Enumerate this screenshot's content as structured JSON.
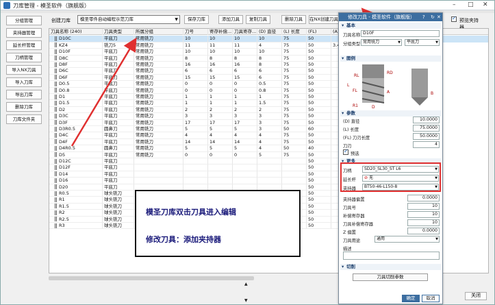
{
  "window": {
    "title": "刀库管理 - 模圣软件（旗舰版）"
  },
  "sidebar": {
    "buttons": [
      "分组管理",
      "夹持器管理",
      "延长杆管理",
      "刀柄管理",
      "导入NX刀具",
      "导入刀库",
      "导出刀库",
      "删除刀库",
      "刀库文件夹"
    ]
  },
  "toolbar": {
    "create_label": "创建刀库",
    "combo_value": "模圣零件自动编程示范刀库",
    "save": "保存刀库",
    "add": "添加刀具",
    "copy": "复制刀具",
    "delete": "删除刀具",
    "nx_create": "在NX创建刀具",
    "preview": "预览夹持器"
  },
  "columns": [
    "刀具名称 (240)",
    "刀具类型",
    "所属分组",
    "刀号",
    "寄存补偿...",
    "刀具寄存...",
    "(D) 直径",
    "(L) 长度",
    "(FL)",
    "(A) 尖角",
    "(B) 锥角"
  ],
  "rows": [
    [
      "D10C",
      "平底刀",
      "常用铣刀",
      "10",
      "10",
      "10",
      "10",
      "75",
      "50",
      "",
      "0"
    ],
    [
      "KZ4",
      "铣刀5",
      "常用铣刀",
      "11",
      "11",
      "11",
      "4",
      "75",
      "50",
      "3.44",
      "0"
    ],
    [
      "D10F",
      "平底刀",
      "常用铣刀",
      "10",
      "10",
      "10",
      "10",
      "75",
      "50",
      "",
      "0"
    ],
    [
      "D8C",
      "平底刀",
      "常用铣刀",
      "8",
      "8",
      "8",
      "8",
      "75",
      "50",
      "",
      "0"
    ],
    [
      "D8F",
      "平底刀",
      "常用铣刀",
      "16",
      "16",
      "16",
      "8",
      "75",
      "50",
      "",
      "0"
    ],
    [
      "D6C",
      "平底刀",
      "常用铣刀",
      "6",
      "6",
      "6",
      "6",
      "75",
      "50",
      "",
      "0"
    ],
    [
      "D6F",
      "平底刀",
      "常用铣刀",
      "15",
      "15",
      "15",
      "6",
      "75",
      "50",
      "",
      "0"
    ],
    [
      "D0.5",
      "平底刀",
      "常用铣刀",
      "0",
      "0",
      "0",
      "0.5",
      "75",
      "50",
      "",
      "0"
    ],
    [
      "D0.8",
      "平底刀",
      "常用铣刀",
      "0",
      "0",
      "0",
      "0.8",
      "75",
      "50",
      "",
      "0"
    ],
    [
      "D1",
      "平底刀",
      "常用铣刀",
      "1",
      "1",
      "1",
      "1",
      "75",
      "50",
      "",
      "0"
    ],
    [
      "D1.5",
      "平底刀",
      "常用铣刀",
      "1",
      "1",
      "1",
      "1.5",
      "75",
      "50",
      "",
      "0"
    ],
    [
      "D2",
      "平底刀",
      "常用铣刀",
      "2",
      "2",
      "2",
      "2",
      "75",
      "50",
      "",
      "0"
    ],
    [
      "D3C",
      "平底刀",
      "常用铣刀",
      "3",
      "3",
      "3",
      "3",
      "75",
      "50",
      "",
      "0"
    ],
    [
      "D3F",
      "平底刀",
      "常用铣刀",
      "17",
      "17",
      "17",
      "3",
      "75",
      "50",
      "",
      "0"
    ],
    [
      "D3R0.5",
      "圆鼻刀",
      "常用铣刀",
      "5",
      "5",
      "5",
      "3",
      "50",
      "60",
      "",
      "0"
    ],
    [
      "D4C",
      "平底刀",
      "常用铣刀",
      "4",
      "4",
      "4",
      "4",
      "75",
      "50",
      "",
      "0"
    ],
    [
      "D4F",
      "平底刀",
      "常用铣刀",
      "14",
      "14",
      "14",
      "4",
      "75",
      "50",
      "",
      "0"
    ],
    [
      "D4R0.5",
      "圆鼻刀",
      "常用铣刀",
      "5",
      "5",
      "5",
      "4",
      "50",
      "40",
      "",
      "0"
    ],
    [
      "D5",
      "平底刀",
      "常用铣刀",
      "0",
      "0",
      "0",
      "5",
      "75",
      "50",
      "",
      "0"
    ],
    [
      "D12C",
      "平底刀",
      "",
      "",
      "",
      "",
      "",
      "",
      "50",
      "",
      "0"
    ],
    [
      "D12F",
      "平底刀",
      "",
      "",
      "",
      "",
      "",
      "",
      "50",
      "",
      "0"
    ],
    [
      "D14",
      "平底刀",
      "",
      "",
      "",
      "",
      "",
      "",
      "50",
      "",
      "0"
    ],
    [
      "D16",
      "平底刀",
      "",
      "",
      "",
      "",
      "",
      "",
      "50",
      "",
      "0"
    ],
    [
      "D20",
      "平底刀",
      "",
      "",
      "",
      "",
      "",
      "",
      "50",
      "",
      "0"
    ],
    [
      "R0.5",
      "球头铣刀",
      "",
      "",
      "",
      "",
      "",
      "",
      "50",
      "",
      "0"
    ],
    [
      "R1",
      "球头铣刀",
      "",
      "",
      "",
      "",
      "",
      "",
      "50",
      "",
      "0"
    ],
    [
      "R1.5",
      "球头铣刀",
      "",
      "",
      "",
      "",
      "",
      "",
      "50",
      "",
      "0"
    ],
    [
      "R2",
      "球头铣刀",
      "",
      "",
      "",
      "",
      "",
      "",
      "50",
      "",
      "0"
    ],
    [
      "R2.5",
      "球头铣刀",
      "常用铣刀",
      "0",
      "0",
      "0",
      "5",
      "75",
      "50",
      "",
      "0"
    ],
    [
      "R3",
      "球头铣刀",
      "常用铣刀",
      "0",
      "0",
      "0",
      "6",
      "75",
      "50",
      "",
      "0"
    ]
  ],
  "annotation": {
    "line1": "模圣刀库双击刀具进入编辑",
    "line2": "修改刀具：添加夹持器"
  },
  "close_button": "关闭",
  "dialog": {
    "title": "修改刀具 - 模圣软件（旗舰版）",
    "tool_name_label": "刀具名称",
    "tool_name": "D10F",
    "group_label": "分组类型",
    "group_value": "常用铣刀",
    "type_value": "平底刀",
    "sec_diagram": "图例",
    "sec_basic": "基本",
    "sec_params": "参数",
    "sec_more": "更多",
    "sec_cut": "切削",
    "diagram_labels": [
      "RD",
      "RL",
      "A",
      "FL",
      "L",
      "D",
      "R1",
      "B"
    ],
    "diameter_label": "(D) 直径",
    "diameter": "10.0000",
    "length_label": "(L) 长度",
    "length": "75.0000",
    "flute_label": "(FL) 刀刃长度",
    "flute": "50.0000",
    "flutes_label": "刀刃",
    "flutes": "4",
    "preselect_label": "预选",
    "holder_label": "刀柄",
    "holder_value": "SD20_SL30_ST L6",
    "ext_label": "延长杆",
    "ext_value": "无",
    "clamp_label": "夹持器",
    "clamp_value": "BT50-46-L150-8",
    "clamp_offset_label": "夹持器偏置",
    "clamp_offset": "0.0000",
    "tool_no_label": "刀具号",
    "tool_no": "10",
    "comp_label": "补偿寄存器",
    "comp": "10",
    "tool_comp_label": "刀具补偿寄存器",
    "tool_comp": "10",
    "z_label": "Z 偏置",
    "z": "0.0000",
    "usage_label": "刀具用途",
    "usage": "通用",
    "desc_label": "描述",
    "cut_params": "刀具切削参数",
    "ok": "确定",
    "cancel": "取消"
  },
  "colors": {
    "accent": "#3c6ea0",
    "highlight": "#e03030"
  }
}
